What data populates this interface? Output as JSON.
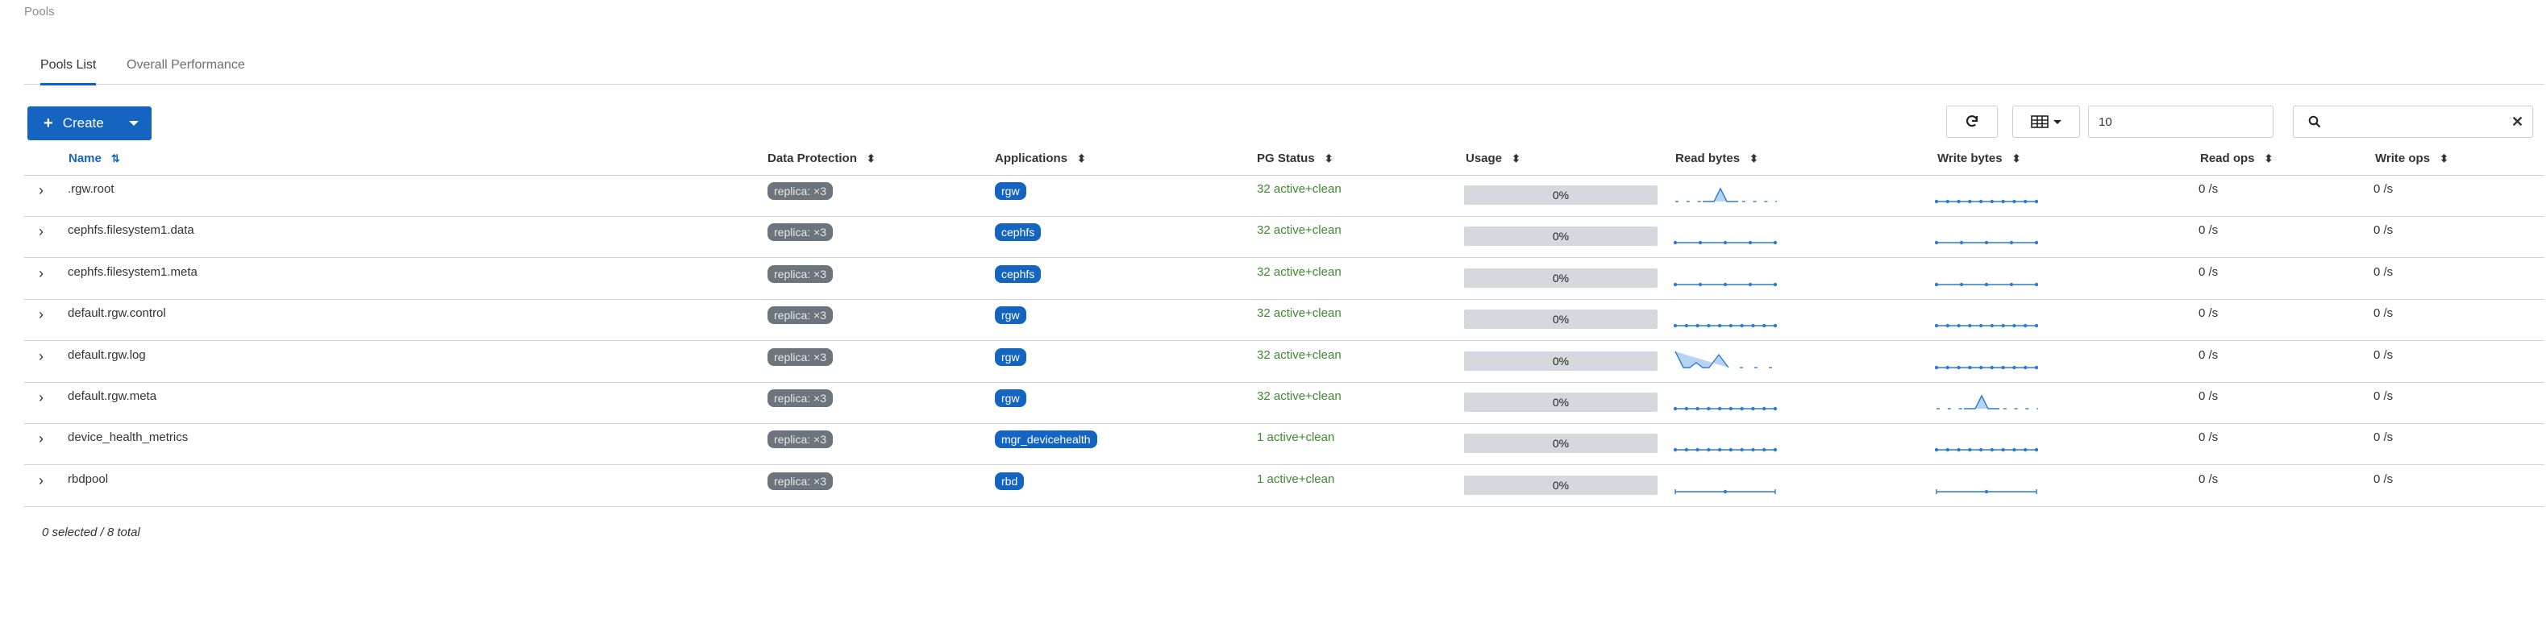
{
  "breadcrumb": "Pools",
  "tabs": [
    {
      "label": "Pools List",
      "active": true
    },
    {
      "label": "Overall Performance",
      "active": false
    }
  ],
  "toolbar": {
    "create_label": "Create",
    "limit_value": "10",
    "search_placeholder": ""
  },
  "columns": {
    "name": "Name",
    "data_protection": "Data Protection",
    "applications": "Applications",
    "pg_status": "PG Status",
    "usage": "Usage",
    "read_bytes": "Read bytes",
    "write_bytes": "Write bytes",
    "read_ops": "Read ops",
    "write_ops": "Write ops"
  },
  "rows": [
    {
      "name": ".rgw.root",
      "protection": "replica: ×3",
      "application": "rgw",
      "pg_status": "32 active+clean",
      "usage": "0%",
      "read_ops": "0 /s",
      "write_ops": "0 /s",
      "read_spark": "peak",
      "write_spark": "flat-dotted"
    },
    {
      "name": "cephfs.filesystem1.data",
      "protection": "replica: ×3",
      "application": "cephfs",
      "pg_status": "32 active+clean",
      "usage": "0%",
      "read_ops": "0 /s",
      "write_ops": "0 /s",
      "read_spark": "flat-sparse",
      "write_spark": "flat-sparse"
    },
    {
      "name": "cephfs.filesystem1.meta",
      "protection": "replica: ×3",
      "application": "cephfs",
      "pg_status": "32 active+clean",
      "usage": "0%",
      "read_ops": "0 /s",
      "write_ops": "0 /s",
      "read_spark": "flat-sparse",
      "write_spark": "flat-sparse"
    },
    {
      "name": "default.rgw.control",
      "protection": "replica: ×3",
      "application": "rgw",
      "pg_status": "32 active+clean",
      "usage": "0%",
      "read_ops": "0 /s",
      "write_ops": "0 /s",
      "read_spark": "flat-dotted",
      "write_spark": "flat-dotted"
    },
    {
      "name": "default.rgw.log",
      "protection": "replica: ×3",
      "application": "rgw",
      "pg_status": "32 active+clean",
      "usage": "0%",
      "read_ops": "0 /s",
      "write_ops": "0 /s",
      "read_spark": "double-peak",
      "write_spark": "flat-dotted"
    },
    {
      "name": "default.rgw.meta",
      "protection": "replica: ×3",
      "application": "rgw",
      "pg_status": "32 active+clean",
      "usage": "0%",
      "read_ops": "0 /s",
      "write_ops": "0 /s",
      "read_spark": "flat-dotted",
      "write_spark": "peak"
    },
    {
      "name": "device_health_metrics",
      "protection": "replica: ×3",
      "application": "mgr_devicehealth",
      "pg_status": "1 active+clean",
      "usage": "0%",
      "read_ops": "0 /s",
      "write_ops": "0 /s",
      "read_spark": "flat-dotted",
      "write_spark": "flat-dotted"
    },
    {
      "name": "rbdpool",
      "protection": "replica: ×3",
      "application": "rbd",
      "pg_status": "1 active+clean",
      "usage": "0%",
      "read_ops": "0 /s",
      "write_ops": "0 /s",
      "read_spark": "flat-one",
      "write_spark": "flat-one"
    }
  ],
  "footer": "0 selected / 8 total",
  "colors": {
    "accent": "#1565c0",
    "pg_ok": "#3c8a2e",
    "badge_grey": "#6c757d",
    "spark": "#2b7cd3"
  },
  "icons": {
    "refresh": "refresh-icon",
    "columns": "table-columns-icon",
    "search": "search-icon",
    "clear": "close-icon",
    "expand": "chevron-right-icon",
    "sort": "sort-icon"
  }
}
